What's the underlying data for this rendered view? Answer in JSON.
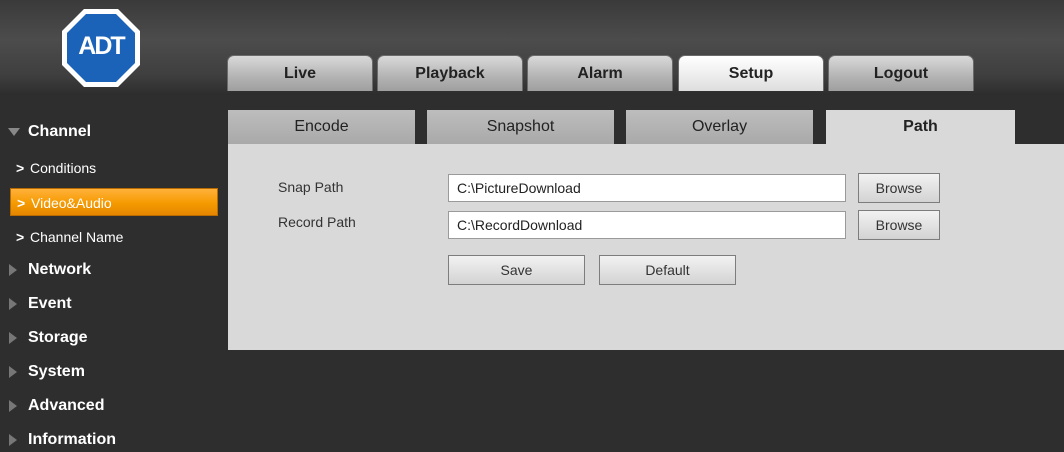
{
  "header": {
    "logo_text": "ADT",
    "tabs": [
      {
        "label": "Live"
      },
      {
        "label": "Playback"
      },
      {
        "label": "Alarm"
      },
      {
        "label": "Setup",
        "active": true
      },
      {
        "label": "Logout"
      }
    ]
  },
  "sidebar": {
    "sections": [
      {
        "label": "Channel",
        "expanded": true
      },
      {
        "label": "Network"
      },
      {
        "label": "Event"
      },
      {
        "label": "Storage"
      },
      {
        "label": "System"
      },
      {
        "label": "Advanced"
      },
      {
        "label": "Information"
      }
    ],
    "channel_items": [
      {
        "label": "Conditions"
      },
      {
        "label": "Video&Audio",
        "active": true
      },
      {
        "label": "Channel Name"
      }
    ]
  },
  "subtabs": [
    {
      "label": "Encode"
    },
    {
      "label": "Snapshot"
    },
    {
      "label": "Overlay"
    },
    {
      "label": "Path",
      "active": true
    }
  ],
  "form": {
    "snap_path_label": "Snap Path",
    "snap_path_value": "C:\\PictureDownload",
    "record_path_label": "Record Path",
    "record_path_value": "C:\\RecordDownload",
    "browse_label": "Browse",
    "save_label": "Save",
    "default_label": "Default"
  },
  "colors": {
    "accent_active": "#f59a00",
    "background": "#2e2e2e",
    "panel": "#d9d9d9"
  }
}
